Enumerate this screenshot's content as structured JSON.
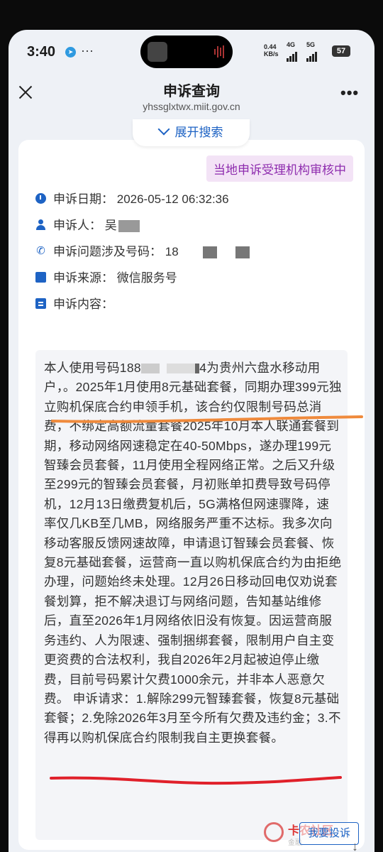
{
  "status_bar": {
    "time": "3:40",
    "dots": "···",
    "net_speed": "0.44",
    "net_unit": "KB/s",
    "net_type_1": "4G",
    "net_type_2": "5G",
    "battery": "57"
  },
  "navbar": {
    "title": "申诉查询",
    "url": "yhssglxtwx.miit.gov.cn",
    "more": "•••"
  },
  "expand_search": {
    "label": "展开搜索"
  },
  "card": {
    "status_badge": "当地申诉受理机构审核中",
    "fields": [
      {
        "label": "申诉日期：",
        "value": "2026-05-12 06:32:36"
      },
      {
        "label": "申诉人：",
        "value": "吴"
      },
      {
        "label": "申诉问题涉及号码：",
        "value": "18"
      },
      {
        "label": "申诉来源：",
        "value": "微信服务号"
      },
      {
        "label": "申诉内容：",
        "value": ""
      }
    ],
    "content_part1": "本人使用号码188",
    "content_part2": "4为贵州六盘水移动用户，。2025年1月使用8元基础套餐，同期办理399元独立购机保底合约申领手机，该合约仅限制号码总消费，不绑定高额流量套餐2025年10月本人联通套餐到期，移动网络网速稳定在40-50Mbps，遂办理199元智臻会员套餐，11月使用全程网络正常。之后又升级至299元的智臻会员套餐，月初账单扣费导致号码停机，12月13日缴费复机后，5G满格但网速骤降，速率仅几KB至几MB，网络服务严重不达标。我多次向移动客服反馈网速故障，申请退订智臻会员套餐、恢复8元基础套餐，运营商一直以购机保底合约为由拒绝办理，问题始终未处理。12月26日移动回电仅劝说套餐划算，拒不解决退订与网络问题，告知基站维修后，直至2026年1月网络依旧没有恢复。因运营商服务违约、人为限速、强制捆绑套餐，限制用户自主变更资费的合法权利，我自2026年2月起被迫停止缴费，目前号码累计欠费1000余元，并非本人恶意欠费。 申诉请求：1.解除299元智臻套餐，恢复8元基础套餐；2.免除2026年3月至今所有欠费及违约金；3.不得再以购机保底合约限制我自主更换套餐。"
  },
  "watermark": {
    "text": "卡农社区",
    "sub": "金融"
  },
  "complain_button": "我要投诉",
  "annotation_colors": {
    "orange": "#ef8a3c",
    "red": "#e0202a"
  }
}
